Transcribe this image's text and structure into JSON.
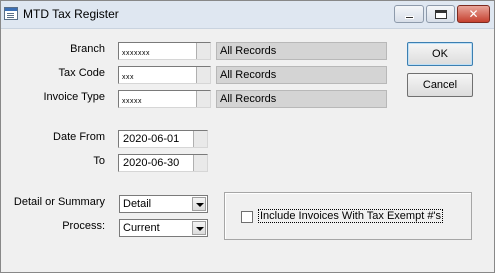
{
  "window": {
    "title": "MTD Tax Register"
  },
  "filters": {
    "branch": {
      "label": "Branch",
      "value": "xxxxxxx",
      "description": "All Records"
    },
    "tax_code": {
      "label": "Tax Code",
      "value": "xxx",
      "description": "All Records"
    },
    "invoice_type": {
      "label": "Invoice Type",
      "value": "xxxxx",
      "description": "All Records"
    }
  },
  "dates": {
    "from_label": "Date From",
    "from_value": "2020-06-01",
    "to_label": "To",
    "to_value": "2020-06-30"
  },
  "options": {
    "detail_label": "Detail or Summary",
    "detail_value": "Detail",
    "process_label": "Process:",
    "process_value": "Current"
  },
  "checkbox": {
    "label": "Include Invoices With Tax Exempt #'s",
    "checked": false
  },
  "buttons": {
    "ok": "OK",
    "cancel": "Cancel"
  }
}
